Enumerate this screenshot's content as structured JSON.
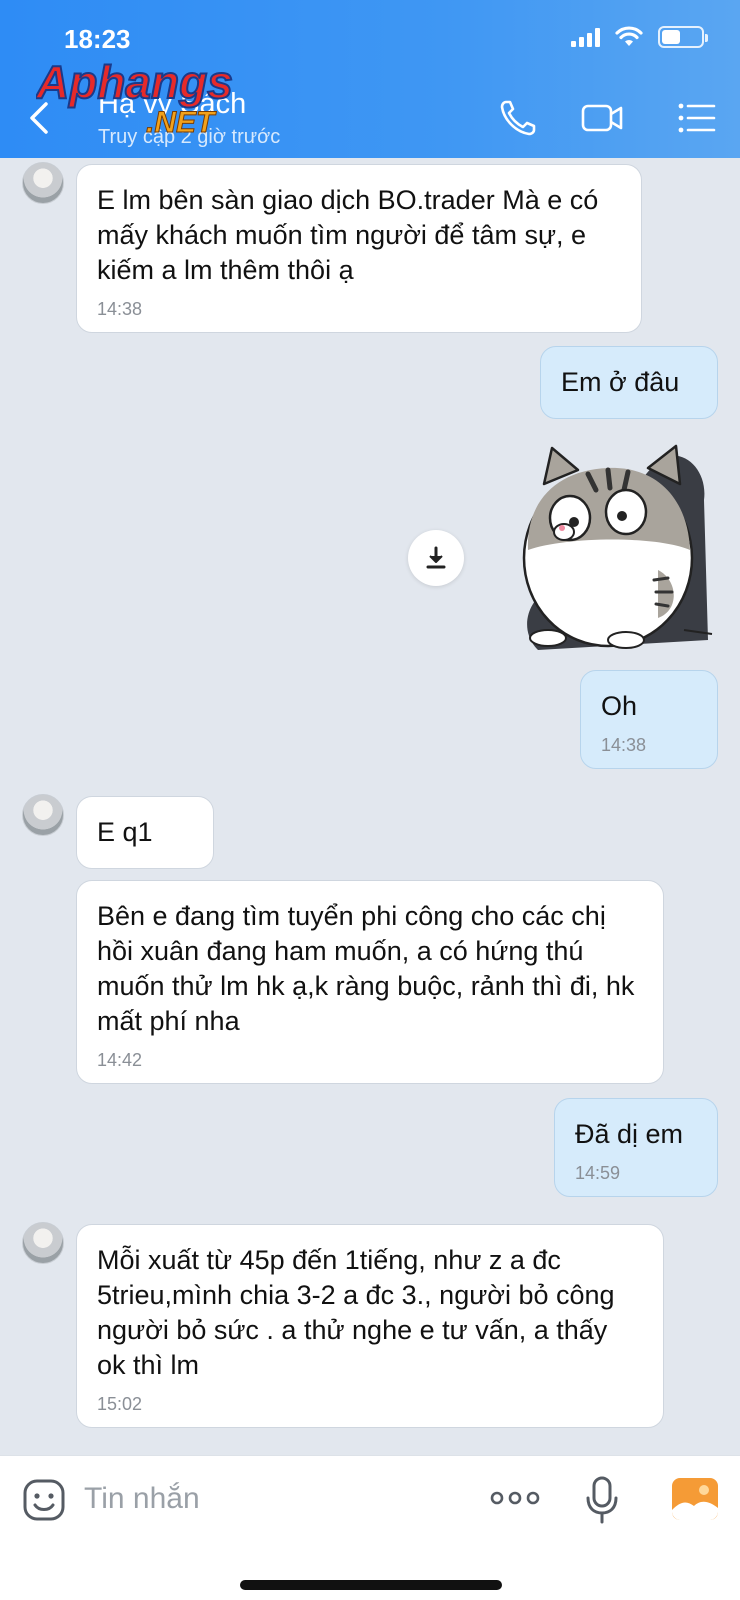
{
  "status_bar": {
    "time": "18:23"
  },
  "header": {
    "name": "Hạ vy Sách",
    "status": "Truy cập 2 giờ trước",
    "watermark": "Aphangs.NET"
  },
  "messages": [
    {
      "text": "E lm bên sàn giao dịch BO.trader Mà e có mấy khách muốn tìm người để tâm sự, e kiếm  a lm thêm thôi ạ",
      "time": "14:38"
    },
    {
      "text": "Em ở đâu"
    },
    {
      "text": "Oh",
      "time": "14:38"
    },
    {
      "text": "E q1"
    },
    {
      "text": "Bên e đang tìm tuyển phi công cho các chị hồi xuân đang ham muốn, a có hứng thú muốn thử lm hk ạ,k ràng buộc, rảnh thì đi, hk mất phí nha",
      "time": "14:42"
    },
    {
      "text": "Đã dị em",
      "time": "14:59"
    },
    {
      "text": " Mỗi xuất từ 45p đến 1tiếng, như z a đc 5trieu,mình chia 3-2 a đc 3., người bỏ công người bỏ sức . a thử nghe e tư vấn, a thấy ok thì lm",
      "time": "15:02"
    }
  ],
  "composer": {
    "placeholder": "Tin nhắn"
  },
  "colors": {
    "header": "#3b93f4",
    "chat_bg": "#e2e7ee",
    "outgoing": "#d6ebfb",
    "incoming": "#ffffff",
    "accent_image_btn": "#f59b36"
  },
  "icons": {
    "back": "back-arrow-icon",
    "call": "phone-icon",
    "video": "video-camera-icon",
    "menu": "list-menu-icon",
    "download": "download-icon",
    "emoji": "emoji-icon",
    "more": "more-dots-icon",
    "mic": "microphone-icon",
    "image": "image-icon"
  }
}
